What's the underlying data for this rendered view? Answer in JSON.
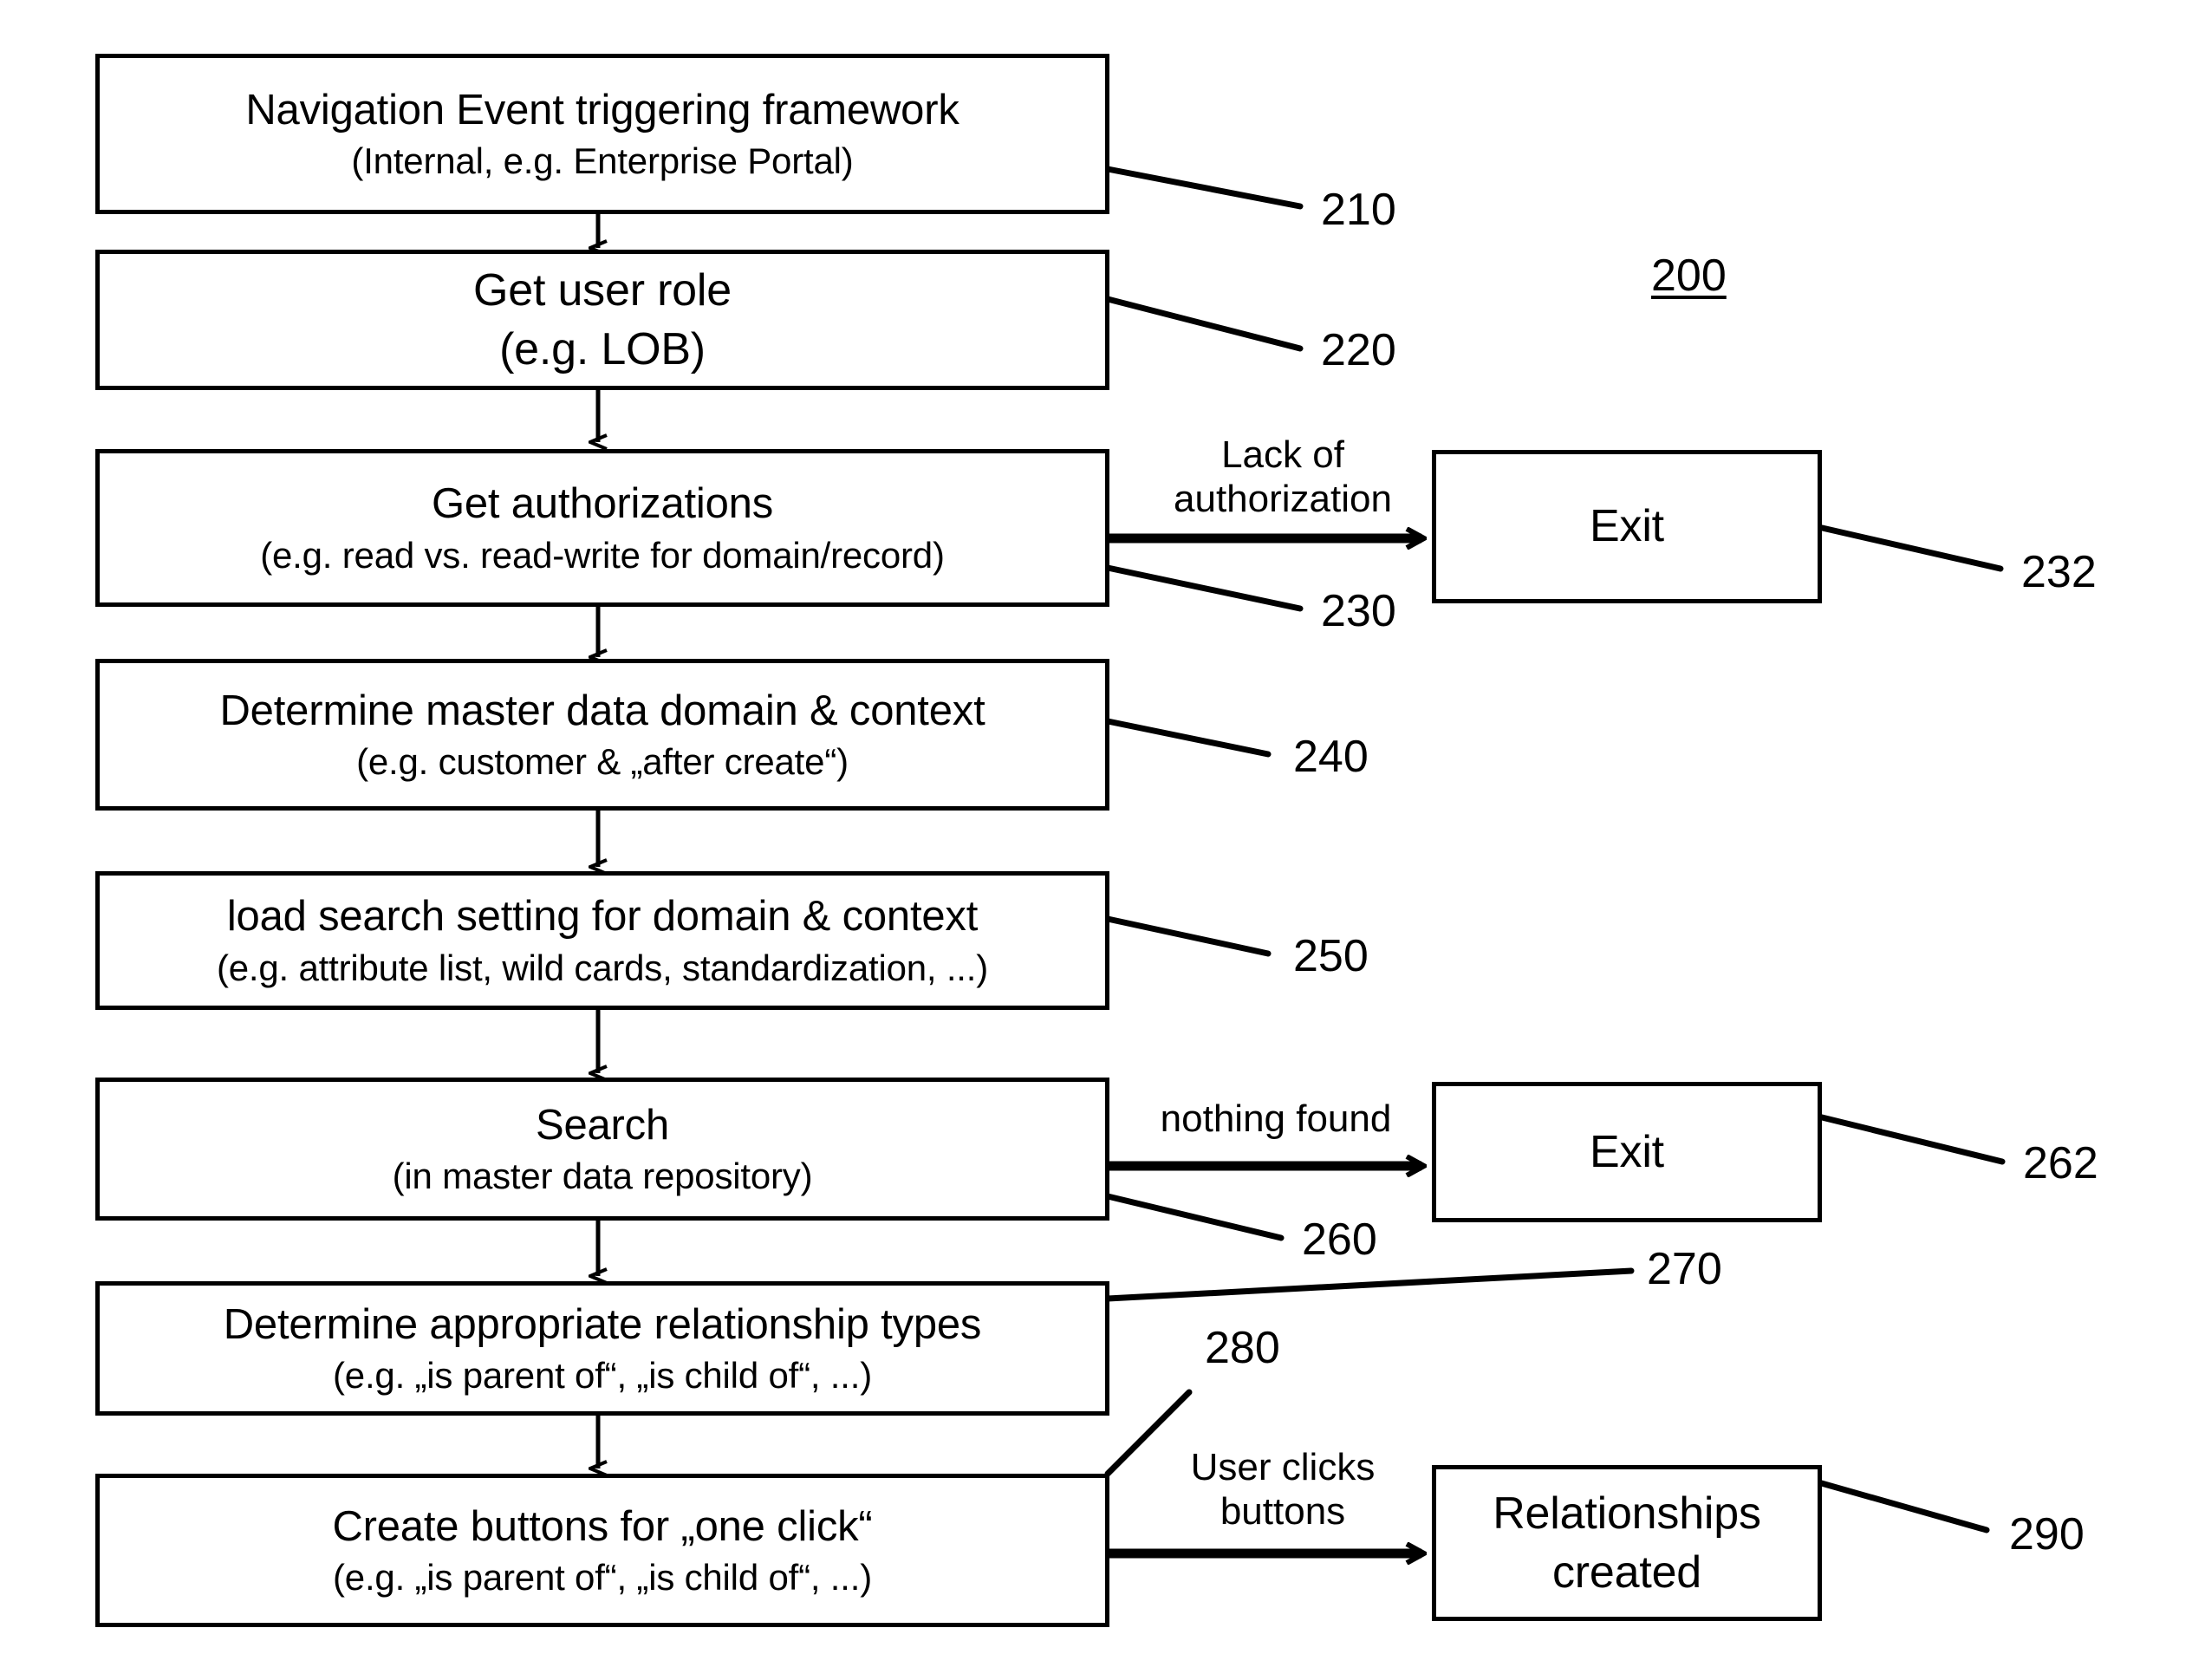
{
  "figure": {
    "number": "200",
    "title_visible": false
  },
  "nodes": [
    {
      "id": "nav-event",
      "line1": "Navigation Event triggering framework",
      "line2": "(Internal, e.g. Enterprise Portal)"
    },
    {
      "id": "get-user-role",
      "line1": "Get user role",
      "line2": "(e.g. LOB)"
    },
    {
      "id": "get-authorizations",
      "line1": "Get authorizations",
      "line2": "(e.g. read vs. read-write for domain/record)"
    },
    {
      "id": "exit-auth",
      "line1": "Exit",
      "line2": ""
    },
    {
      "id": "determine-domain",
      "line1": "Determine master data domain & context",
      "line2": "(e.g. customer & „after create“)"
    },
    {
      "id": "load-search-setting",
      "line1": "load search setting for domain & context",
      "line2": "(e.g. attribute list, wild cards, standardization, ...)"
    },
    {
      "id": "search",
      "line1": "Search",
      "line2": "(in master data repository)"
    },
    {
      "id": "exit-search",
      "line1": "Exit",
      "line2": ""
    },
    {
      "id": "determine-rel-types",
      "line1": "Determine appropriate relationship types",
      "line2": "(e.g. „is parent of“, „is child of“, ...)"
    },
    {
      "id": "create-buttons",
      "line1": "Create buttons for „one click“",
      "line2": "(e.g. „is parent of“, „is child of“, ...)"
    },
    {
      "id": "relationships-created",
      "line1": "Relationships",
      "line2": "created"
    }
  ],
  "edge_labels": [
    {
      "id": "lack-of-authorization",
      "line1": "Lack of",
      "line2": "authorization"
    },
    {
      "id": "nothing-found",
      "line1": "nothing found",
      "line2": ""
    },
    {
      "id": "user-clicks-buttons",
      "line1": "User clicks",
      "line2": "buttons"
    }
  ],
  "reference_numerals": [
    {
      "id": "ref-200",
      "value": "200",
      "underlined": true
    },
    {
      "id": "ref-210",
      "value": "210",
      "underlined": false
    },
    {
      "id": "ref-220",
      "value": "220",
      "underlined": false
    },
    {
      "id": "ref-230",
      "value": "230",
      "underlined": false
    },
    {
      "id": "ref-232",
      "value": "232",
      "underlined": false
    },
    {
      "id": "ref-240",
      "value": "240",
      "underlined": false
    },
    {
      "id": "ref-250",
      "value": "250",
      "underlined": false
    },
    {
      "id": "ref-260",
      "value": "260",
      "underlined": false
    },
    {
      "id": "ref-262",
      "value": "262",
      "underlined": false
    },
    {
      "id": "ref-270",
      "value": "270",
      "underlined": false
    },
    {
      "id": "ref-280",
      "value": "280",
      "underlined": false
    },
    {
      "id": "ref-290",
      "value": "290",
      "underlined": false
    }
  ],
  "colors": {
    "stroke": "#000000",
    "background": "#ffffff",
    "text": "#000000"
  }
}
